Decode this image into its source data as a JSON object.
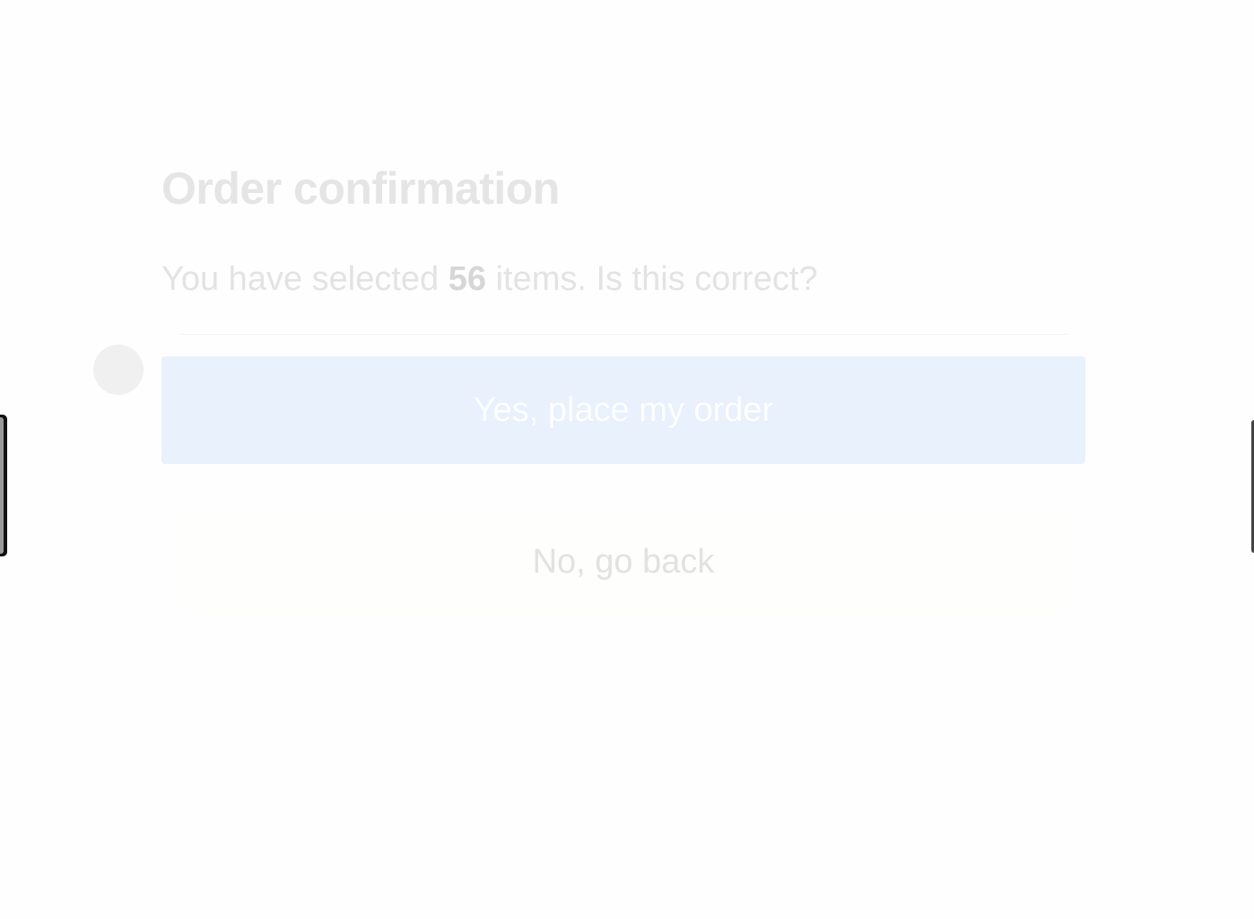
{
  "dialog": {
    "title": "Order confirmation",
    "message_prefix": "You have selected",
    "item_count": "56",
    "message_suffix": "items. Is this correct?",
    "confirm_label": "Yes, place my order",
    "cancel_label": "No, go back"
  },
  "colors": {
    "confirm_background": "#e9f1fd",
    "page_background": "#fefefe"
  }
}
